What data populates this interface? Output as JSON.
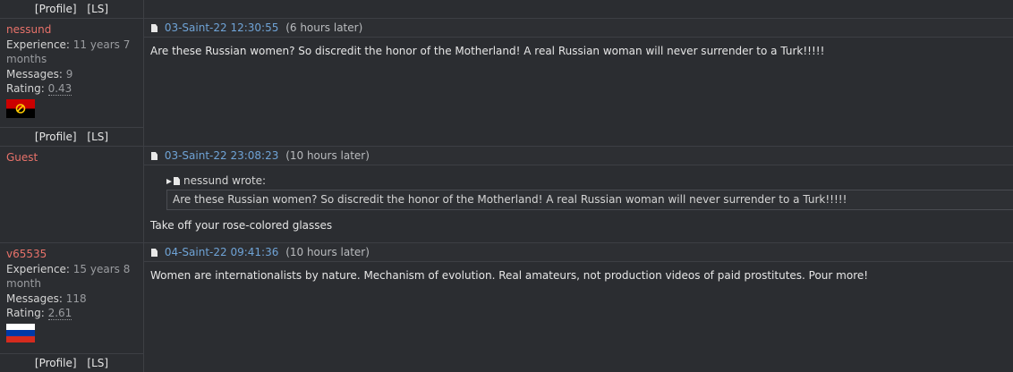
{
  "profile_links": {
    "profile": "[Profile]",
    "ls": "[LS]"
  },
  "posts": [
    {
      "author": "nessund",
      "experience_label": "Experience:",
      "experience_value": "11 years 7 months",
      "messages_label": "Messages:",
      "messages_value": "9",
      "rating_label": "Rating:",
      "rating_value": "0.43",
      "flag": "angola-flag",
      "date": "03-Saint-22 12:30:55",
      "later": "(6 hours later)",
      "body": "Are these Russian women? So discredit the honor of the Motherland! A real Russian woman will never surrender to a Turk!!!!!"
    },
    {
      "author": "Guest",
      "date": "03-Saint-22 23:08:23",
      "later": "(10 hours later)",
      "quote_author": "nessund wrote:",
      "quote_text": "Are these Russian women? So discredit the honor of the Motherland! A real Russian woman will never surrender to a Turk!!!!!",
      "body": "Take off your rose-colored glasses"
    },
    {
      "author": "v65535",
      "experience_label": "Experience:",
      "experience_value": "15 years 8 month",
      "messages_label": "Messages:",
      "messages_value": "118",
      "rating_label": "Rating:",
      "rating_value": "2.61",
      "flag": "russia-flag",
      "date": "04-Saint-22 09:41:36",
      "later": "(10 hours later)",
      "body": "Women are internationalists by nature. Mechanism of evolution. Real amateurs, not production videos of paid prostitutes. Pour more!"
    }
  ]
}
